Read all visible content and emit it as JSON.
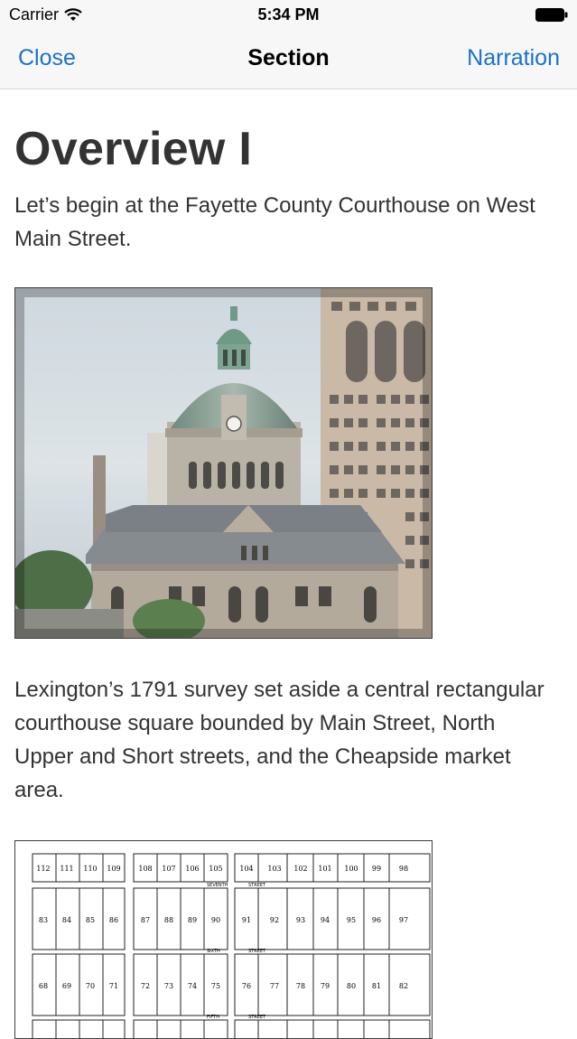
{
  "status_bar": {
    "carrier": "Carrier",
    "time": "5:34 PM"
  },
  "nav": {
    "left": "Close",
    "title": "Section",
    "right": "Narration"
  },
  "content": {
    "heading": "Overview I",
    "intro": "Let’s begin at the Fayette County Courthouse on West Main Street.",
    "body": "Lexington’s 1791 survey set aside a central rectangular courthouse square bounded by Main Street, North Upper and Short streets, and the Cheapside market area."
  },
  "plat": {
    "row1": [
      "112",
      "111",
      "110",
      "109",
      "108",
      "107",
      "106",
      "105",
      "104",
      "103",
      "102",
      "101",
      "100",
      "99",
      "98"
    ],
    "row2": [
      "83",
      "84",
      "85",
      "86",
      "87",
      "88",
      "89",
      "90",
      "91",
      "92",
      "93",
      "94",
      "95",
      "96",
      "97"
    ],
    "row3": [
      "68",
      "69",
      "70",
      "71",
      "72",
      "73",
      "74",
      "75",
      "76",
      "77",
      "78",
      "79",
      "80",
      "81",
      "82"
    ],
    "street_labels": [
      "SEVENTH",
      "STREET",
      "SIXTH",
      "STREET",
      "FIFTH",
      "STREET"
    ]
  },
  "icons": {
    "wifi": "wifi-icon",
    "battery": "battery-icon"
  }
}
